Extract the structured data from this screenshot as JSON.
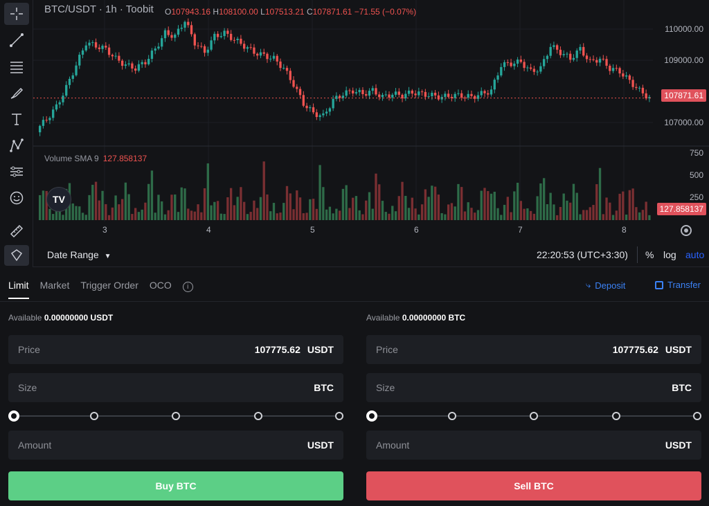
{
  "chart": {
    "symbol_title": "BTC/USDT · 1h · Toobit",
    "ohlc": {
      "o_label": "O",
      "o": "107943.16",
      "h_label": "H",
      "h": "108100.00",
      "l_label": "L",
      "l": "107513.21",
      "c_label": "C",
      "c": "107871.61",
      "change": "−71.55 (−0.07%)"
    },
    "y_labels": [
      "110000.00",
      "109000.00",
      "107000.00"
    ],
    "last_price_tag": "107871.61",
    "volume": {
      "label": "Volume SMA 9",
      "value": "127.858137",
      "y_labels": [
        "750",
        "500",
        "250"
      ],
      "tag": "127.858137"
    },
    "x_labels": [
      "3",
      "4",
      "5",
      "6",
      "7",
      "8"
    ],
    "colors": {
      "up": "#26a69a",
      "down": "#ef5350",
      "up_vol": "#2e6b48",
      "down_vol": "#7a2f32"
    }
  },
  "chart_data": {
    "type": "candlestick",
    "title": "BTC/USDT · 1h · Toobit",
    "x_ticks": [
      "3",
      "4",
      "5",
      "6",
      "7",
      "8"
    ],
    "ylim": [
      106500,
      110500
    ],
    "close_path": [
      106900,
      107200,
      107600,
      108200,
      108900,
      109600,
      109500,
      109400,
      109100,
      108900,
      108800,
      109000,
      109400,
      109900,
      109800,
      110300,
      109600,
      109300,
      109800,
      109900,
      109700,
      109500,
      109300,
      109200,
      109100,
      108800,
      108300,
      107700,
      107400,
      107300,
      107800,
      108000,
      108100,
      108000,
      108100,
      107900,
      108000,
      107950,
      108050,
      108000,
      107950,
      107900,
      107950,
      107950,
      107900,
      108000,
      108100,
      108900,
      108950,
      109000,
      108700,
      108800,
      109500,
      109300,
      109100,
      109400,
      109000,
      109100,
      108800,
      108700,
      108400,
      108100,
      107871.61
    ],
    "volume": {
      "sma_label": "Volume SMA 9",
      "sma_value": 127.858137,
      "ylim": [
        0,
        800
      ]
    },
    "last_price": 107871.61
  },
  "date_range": {
    "label": "Date Range"
  },
  "status": {
    "clock": "22:20:53 (UTC+3:30)",
    "pct": "%",
    "log": "log",
    "auto": "auto"
  },
  "order": {
    "tabs": [
      "Limit",
      "Market",
      "Trigger Order",
      "OCO"
    ],
    "deposit": "Deposit",
    "transfer": "Transfer",
    "buy": {
      "available_label": "Available",
      "available_value": "0.00000000 USDT",
      "price_label": "Price",
      "price_value": "107775.62",
      "price_unit": "USDT",
      "size_label": "Size",
      "size_unit": "BTC",
      "amount_label": "Amount",
      "amount_unit": "USDT",
      "button": "Buy BTC"
    },
    "sell": {
      "available_label": "Available",
      "available_value": "0.00000000 BTC",
      "price_label": "Price",
      "price_value": "107775.62",
      "price_unit": "USDT",
      "size_label": "Size",
      "size_unit": "BTC",
      "amount_label": "Amount",
      "amount_unit": "USDT",
      "button": "Sell BTC"
    }
  }
}
